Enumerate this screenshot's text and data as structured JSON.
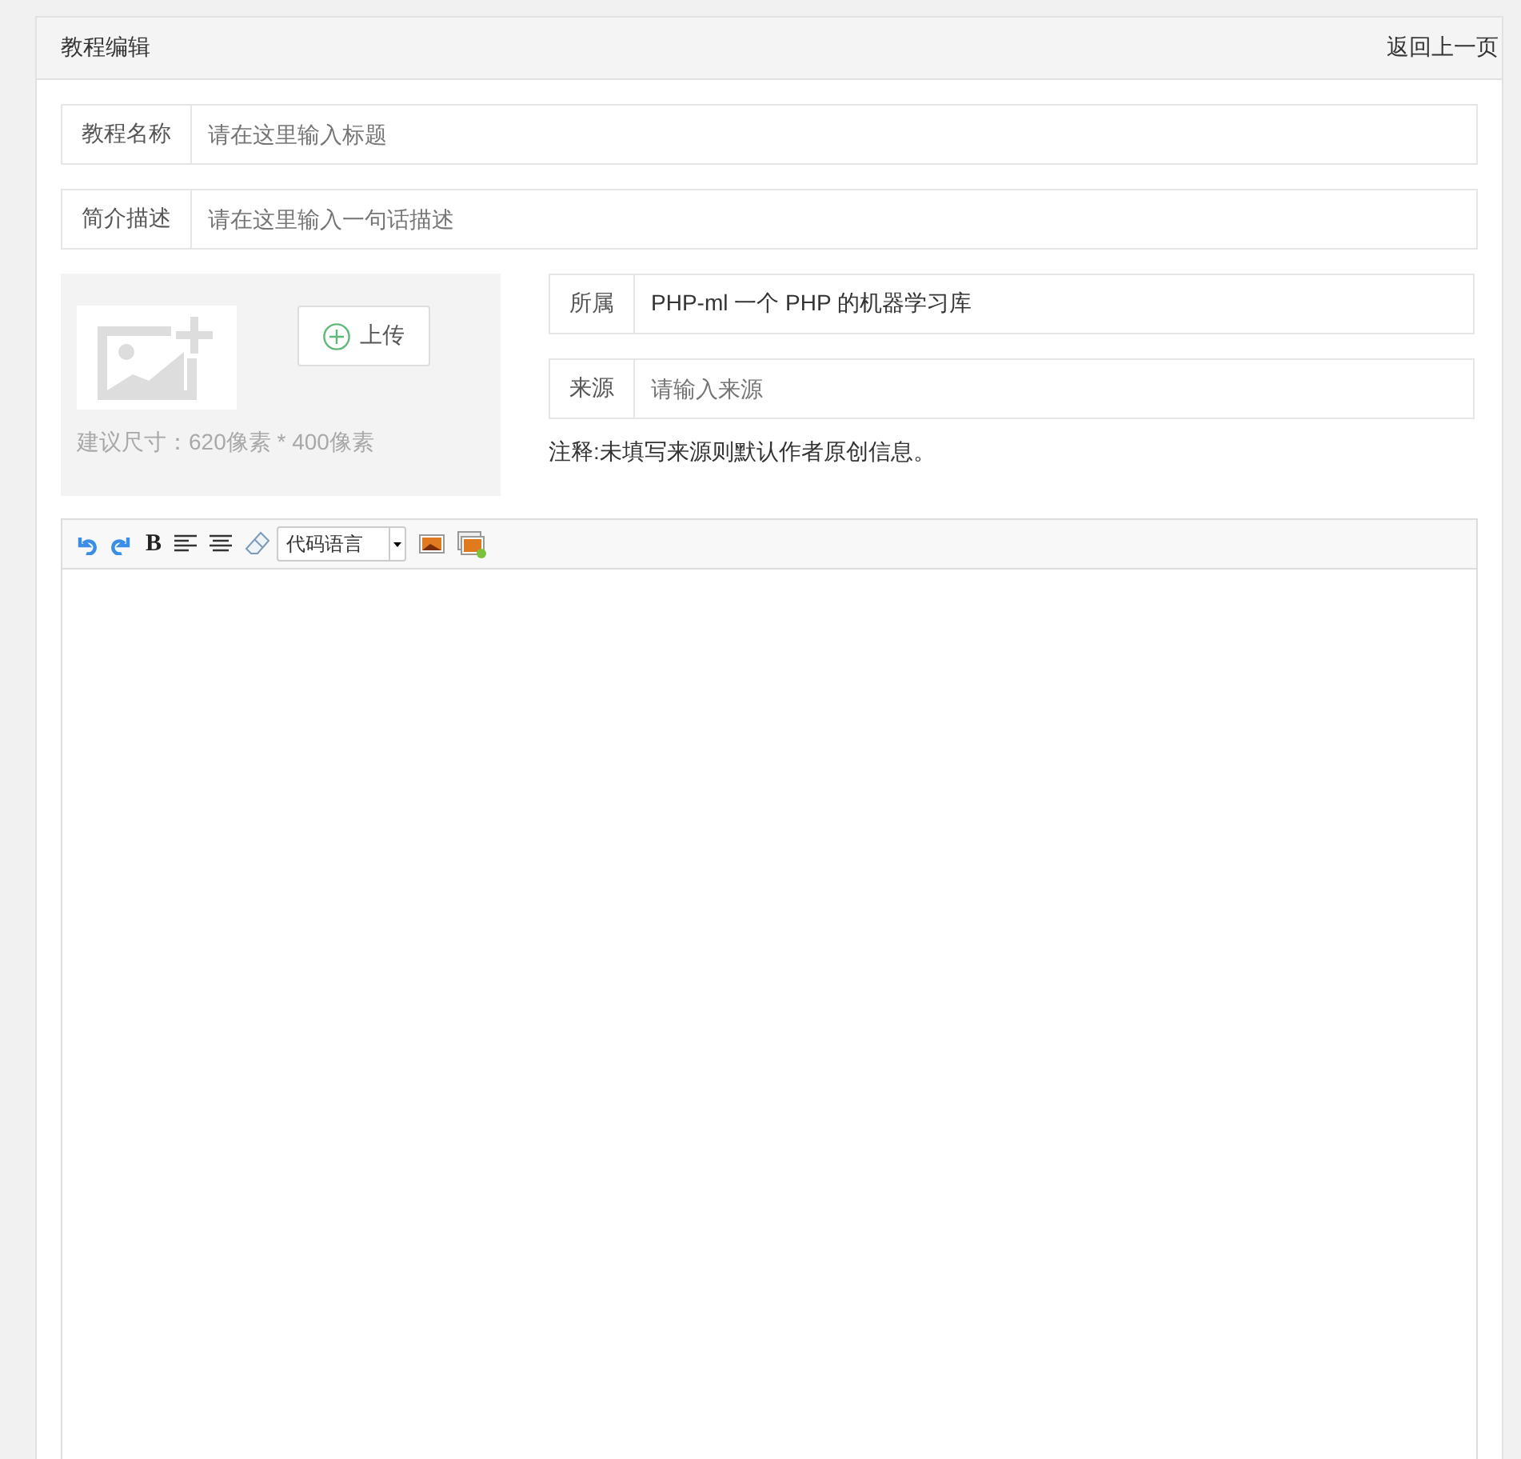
{
  "header": {
    "title": "教程编辑",
    "back_link": "返回上一页"
  },
  "fields": [
    {
      "label": "教程名称",
      "placeholder": "请在这里输入标题"
    },
    {
      "label": "简介描述",
      "placeholder": "请在这里输入一句话描述"
    }
  ],
  "cover": {
    "upload_button": "上传",
    "hint": "建议尺寸：620像素 * 400像素"
  },
  "side_fields": [
    {
      "label": "所属",
      "value": "PHP-ml 一个 PHP 的机器学习库"
    },
    {
      "label": "来源",
      "placeholder": "请输入来源"
    }
  ],
  "note": "注释:未填写来源则默认作者原创信息。",
  "editor": {
    "toolbar": [
      {
        "kind": "undo"
      },
      {
        "kind": "redo"
      },
      {
        "kind": "bold",
        "label": "B"
      },
      {
        "kind": "align-left"
      },
      {
        "kind": "align-center"
      },
      {
        "kind": "eraser"
      },
      {
        "kind": "select",
        "label": "代码语言"
      },
      {
        "kind": "image"
      },
      {
        "kind": "gallery"
      }
    ]
  }
}
